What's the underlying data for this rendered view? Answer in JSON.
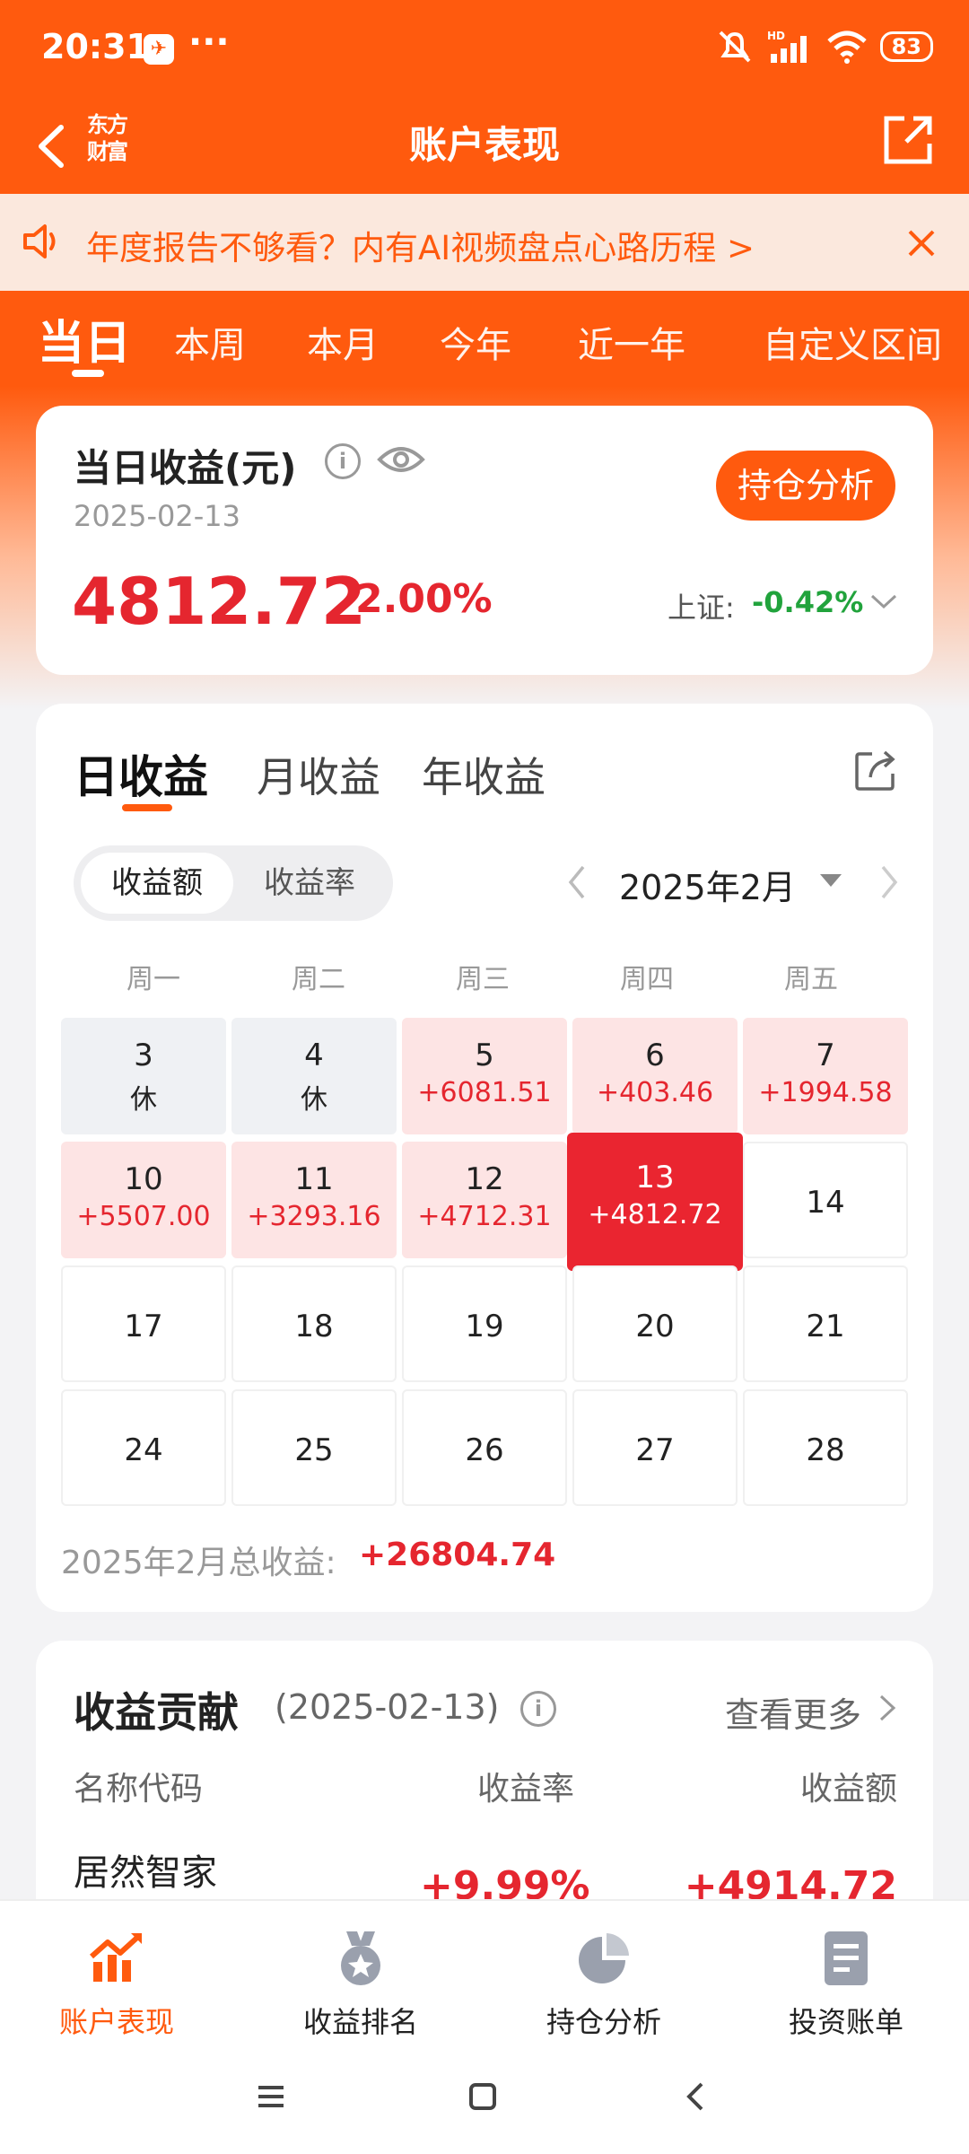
{
  "status_bar": {
    "time": "20:31",
    "dots": "···",
    "network": "HD",
    "battery": "83"
  },
  "header": {
    "brand_line1": "东方",
    "brand_line2": "财富",
    "title": "账户表现"
  },
  "banner": {
    "text": "年度报告不够看？内有AI视频盘点心路历程 >"
  },
  "period_tabs": [
    "当日",
    "本周",
    "本月",
    "今年",
    "近一年",
    "自定义区间"
  ],
  "summary": {
    "title": "当日收益(元)",
    "info": "i",
    "date": "2025-02-13",
    "analysis_button": "持仓分析",
    "amount": "4812.72",
    "rate": "2.00%",
    "index_label": "上证:",
    "index_value": "-0.42%"
  },
  "calendar": {
    "tabs": [
      "日收益",
      "月收益",
      "年收益"
    ],
    "toggle": [
      "收益额",
      "收益率"
    ],
    "month": "2025年2月",
    "weekdays": [
      "周一",
      "周二",
      "周三",
      "周四",
      "周五"
    ],
    "weeks": [
      [
        {
          "day": "3",
          "value": "休",
          "state": "rest"
        },
        {
          "day": "4",
          "value": "休",
          "state": "rest"
        },
        {
          "day": "5",
          "value": "+6081.51",
          "state": "gain"
        },
        {
          "day": "6",
          "value": "+403.46",
          "state": "gain"
        },
        {
          "day": "7",
          "value": "+1994.58",
          "state": "gain"
        }
      ],
      [
        {
          "day": "10",
          "value": "+5507.00",
          "state": "gain"
        },
        {
          "day": "11",
          "value": "+3293.16",
          "state": "gain"
        },
        {
          "day": "12",
          "value": "+4712.31",
          "state": "gain"
        },
        {
          "day": "13",
          "value": "+4812.72",
          "state": "today"
        },
        {
          "day": "14",
          "value": "",
          "state": "empty"
        }
      ],
      [
        {
          "day": "17",
          "value": "",
          "state": "empty"
        },
        {
          "day": "18",
          "value": "",
          "state": "empty"
        },
        {
          "day": "19",
          "value": "",
          "state": "empty"
        },
        {
          "day": "20",
          "value": "",
          "state": "empty"
        },
        {
          "day": "21",
          "value": "",
          "state": "empty"
        }
      ],
      [
        {
          "day": "24",
          "value": "",
          "state": "empty"
        },
        {
          "day": "25",
          "value": "",
          "state": "empty"
        },
        {
          "day": "26",
          "value": "",
          "state": "empty"
        },
        {
          "day": "27",
          "value": "",
          "state": "empty"
        },
        {
          "day": "28",
          "value": "",
          "state": "empty"
        }
      ]
    ],
    "month_total_label": "2025年2月总收益:",
    "month_total_value": "+26804.74"
  },
  "contribution": {
    "title": "收益贡献",
    "date": "(2025-02-13)",
    "view_more": "查看更多",
    "columns": [
      "名称代码",
      "收益率",
      "收益额"
    ],
    "rows": [
      {
        "name": "居然智家",
        "rate": "+9.99%",
        "amount": "+4914.72"
      }
    ]
  },
  "bottom_nav": [
    {
      "label": "账户表现",
      "icon": "trend-chart-icon",
      "active": true
    },
    {
      "label": "收益排名",
      "icon": "medal-icon",
      "active": false
    },
    {
      "label": "持仓分析",
      "icon": "pie-chart-icon",
      "active": false
    },
    {
      "label": "投资账单",
      "icon": "document-icon",
      "active": false
    }
  ],
  "colors": {
    "brand": "#ff5a0e",
    "gain": "#e5262f",
    "loss": "#21a33c"
  }
}
